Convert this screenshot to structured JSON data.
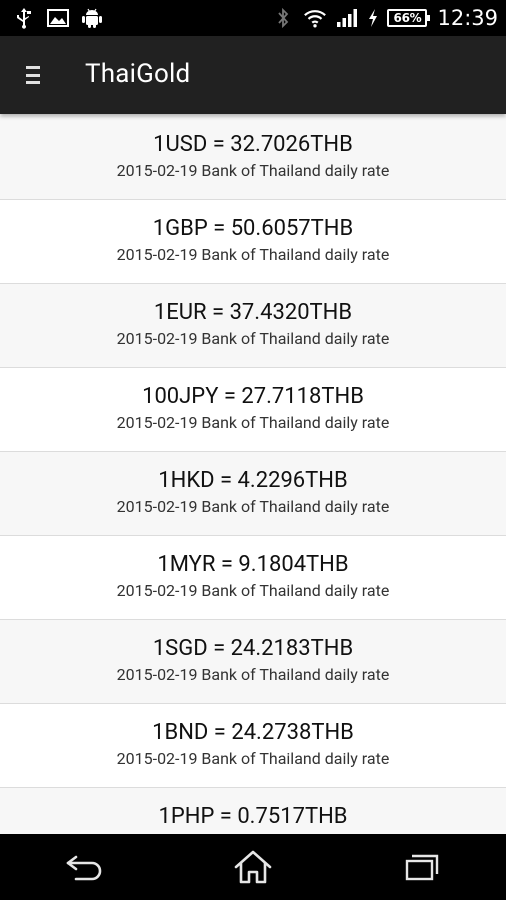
{
  "status_bar": {
    "battery": "66%",
    "time": "12:39",
    "left_icons": [
      "usb-icon",
      "image-icon",
      "android-icon"
    ],
    "right_icons": [
      "bluetooth-icon",
      "wifi-icon",
      "signal-icon",
      "charging-icon",
      "battery-icon"
    ]
  },
  "action_bar": {
    "title": "ThaiGold",
    "menu_icon": "menu-icon"
  },
  "rates": [
    {
      "value": "1USD = 32.7026THB",
      "source": "2015-02-19 Bank of Thailand daily rate"
    },
    {
      "value": "1GBP = 50.6057THB",
      "source": "2015-02-19 Bank of Thailand daily rate"
    },
    {
      "value": "1EUR = 37.4320THB",
      "source": "2015-02-19 Bank of Thailand daily rate"
    },
    {
      "value": "100JPY = 27.7118THB",
      "source": "2015-02-19 Bank of Thailand daily rate"
    },
    {
      "value": "1HKD = 4.2296THB",
      "source": "2015-02-19 Bank of Thailand daily rate"
    },
    {
      "value": "1MYR = 9.1804THB",
      "source": "2015-02-19 Bank of Thailand daily rate"
    },
    {
      "value": "1SGD = 24.2183THB",
      "source": "2015-02-19 Bank of Thailand daily rate"
    },
    {
      "value": "1BND = 24.2738THB",
      "source": "2015-02-19 Bank of Thailand daily rate"
    },
    {
      "value": "1PHP = 0.7517THB",
      "source": ""
    }
  ],
  "nav_bar": {
    "buttons": [
      "back-icon",
      "home-icon",
      "recents-icon"
    ]
  },
  "colors": {
    "status_bar": "#000000",
    "action_bar": "#212121",
    "row_odd": "#f7f7f7",
    "row_even": "#ffffff",
    "divider": "#dcdcdc",
    "nav_bar": "#000000"
  }
}
